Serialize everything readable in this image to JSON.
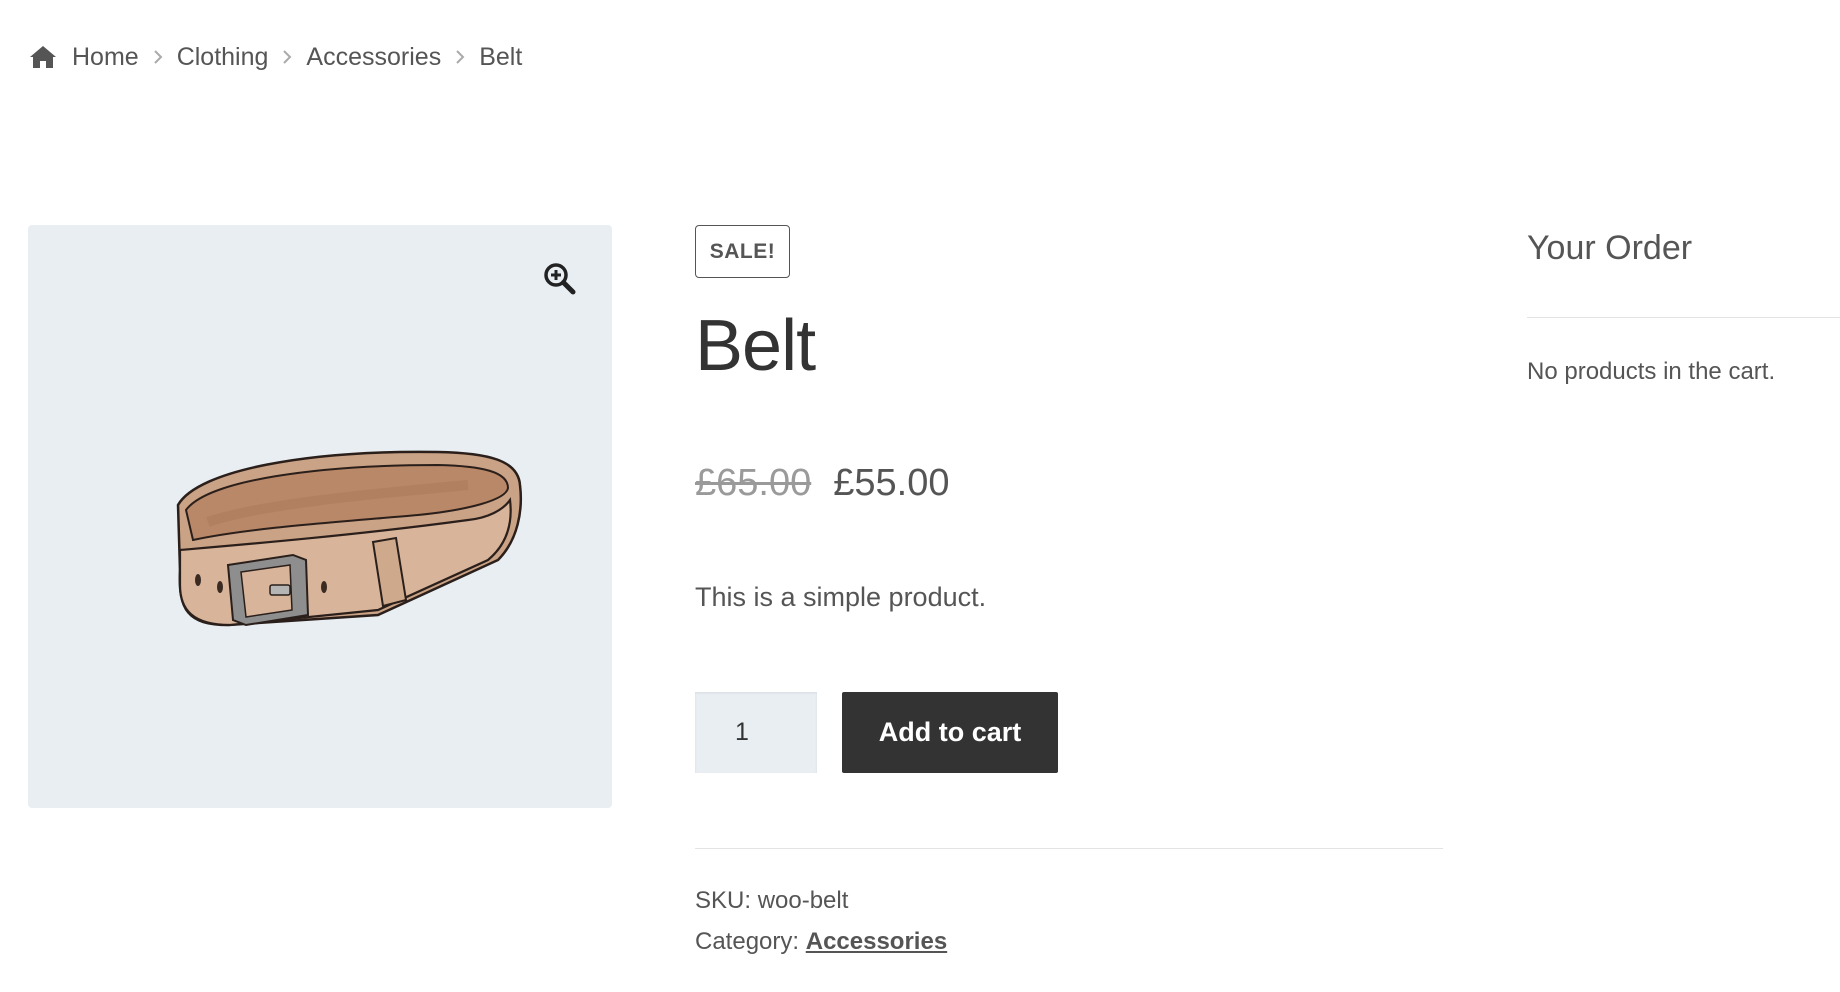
{
  "breadcrumb": {
    "home_icon": "home-icon",
    "items": [
      "Home",
      "Clothing",
      "Accessories"
    ],
    "current": "Belt"
  },
  "gallery": {
    "zoom_icon": "zoom-in-icon",
    "image": "belt product illustration"
  },
  "product": {
    "badge": "SALE!",
    "title": "Belt",
    "price_old": "£65.00",
    "price_new": "£55.00",
    "short_description": "This is a simple product.",
    "quantity": "1",
    "add_to_cart_label": "Add to cart",
    "sku_label": "SKU:",
    "sku_value": "woo-belt",
    "category_label": "Category:",
    "category_value": "Accessories"
  },
  "sidebar": {
    "title": "Your Order",
    "empty_message": "No products in the cart."
  },
  "colors": {
    "button_bg": "#333333",
    "image_bg": "#e9eef3",
    "text": "#555555",
    "old_price": "#9a9a9a"
  }
}
